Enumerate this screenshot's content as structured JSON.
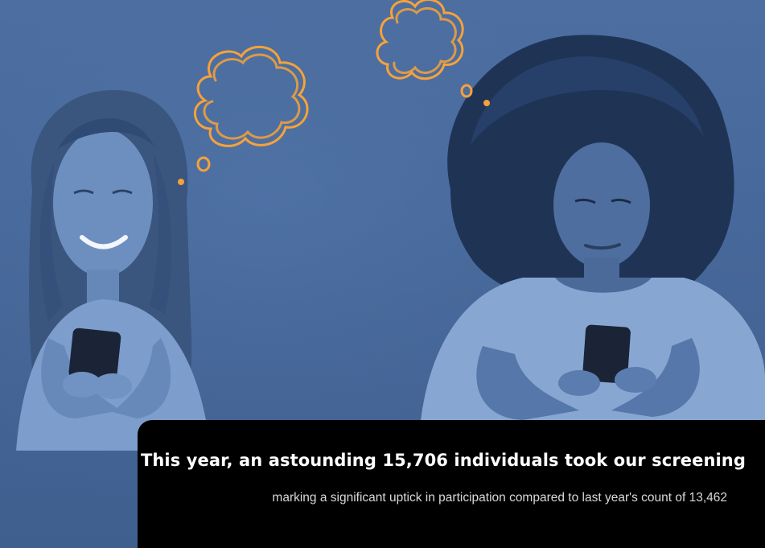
{
  "background": {
    "tint_color": "#4a6a9c",
    "accent_color": "#f5a23a"
  },
  "top_fragment": "",
  "stat_card": {
    "headline": "This year, an astounding 15,706 individuals took our screening",
    "subtext": "marking a significant uptick in participation compared to last year's count of 13,462"
  }
}
